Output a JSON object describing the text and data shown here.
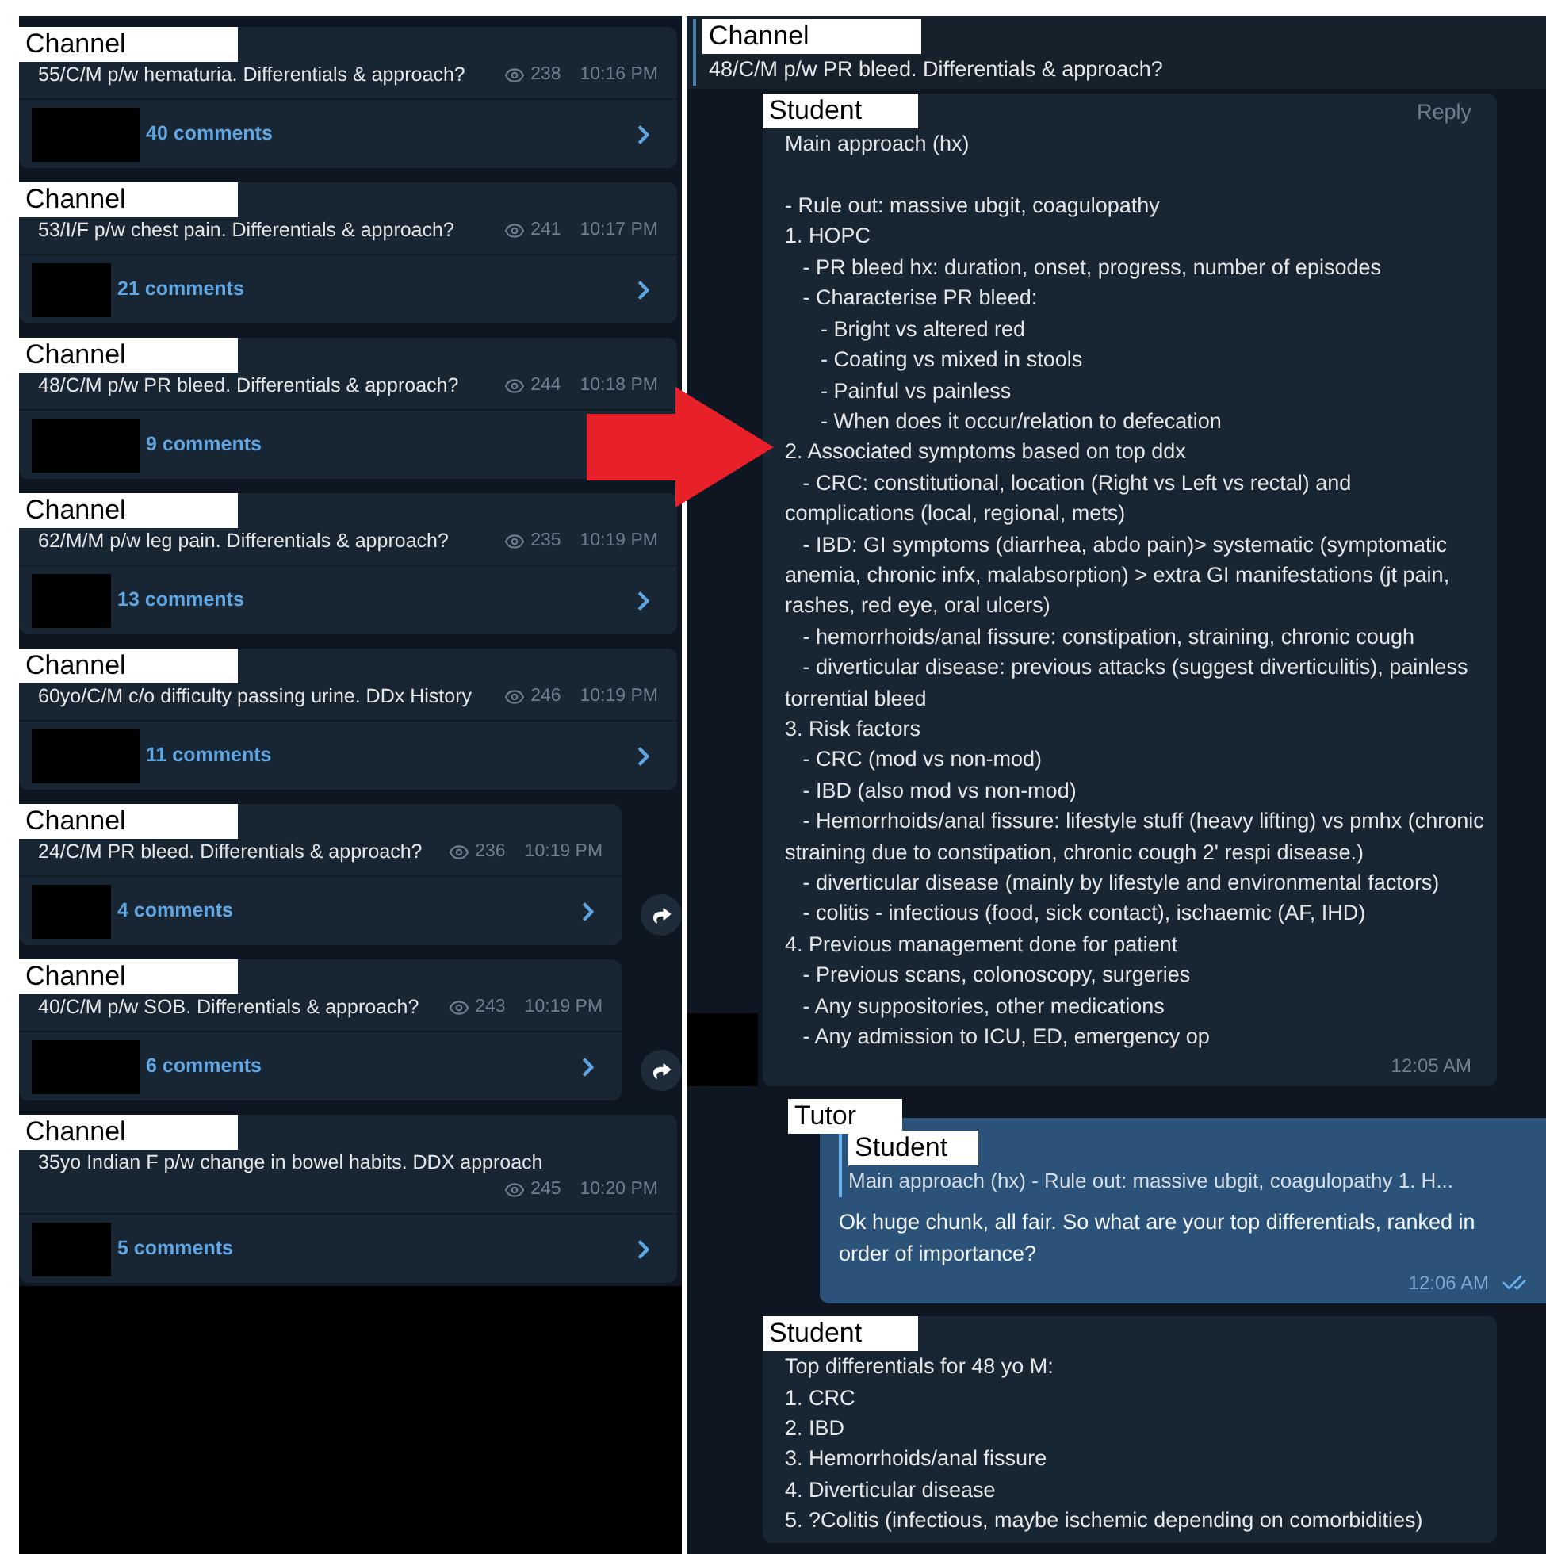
{
  "posts": [
    {
      "channel": "Channel",
      "text": "55/C/M p/w hematuria. Differentials & approach?",
      "views": "238",
      "time": "10:16 PM",
      "comments": "40 comments",
      "share_button": false,
      "arrow_annotation": false
    },
    {
      "channel": "Channel",
      "text": "53/I/F p/w chest pain. Differentials & approach?",
      "views": "241",
      "time": "10:17 PM",
      "comments": "21 comments",
      "share_button": false,
      "arrow_annotation": false
    },
    {
      "channel": "Channel",
      "text": "48/C/M p/w PR bleed. Differentials & approach?",
      "views": "244",
      "time": "10:18 PM",
      "comments": "9 comments",
      "share_button": false,
      "arrow_annotation": true
    },
    {
      "channel": "Channel",
      "text": "62/M/M p/w leg pain. Differentials & approach?",
      "views": "235",
      "time": "10:19 PM",
      "comments": "13 comments",
      "share_button": false,
      "arrow_annotation": false
    },
    {
      "channel": "Channel",
      "text": "60yo/C/M c/o difficulty passing urine. DDx History",
      "views": "246",
      "time": "10:19 PM",
      "comments": "11 comments",
      "share_button": false,
      "arrow_annotation": false
    },
    {
      "channel": "Channel",
      "text": "24/C/M PR bleed. Differentials & approach?",
      "views": "236",
      "time": "10:19 PM",
      "comments": "4 comments",
      "share_button": true,
      "arrow_annotation": false
    },
    {
      "channel": "Channel",
      "text": "40/C/M p/w SOB. Differentials & approach?",
      "views": "243",
      "time": "10:19 PM",
      "comments": "6 comments",
      "share_button": true,
      "arrow_annotation": false
    },
    {
      "channel": "Channel",
      "text": "35yo Indian F p/w change in bowel habits. DDX approach",
      "views": "245",
      "time": "10:20 PM",
      "comments": "5 comments",
      "share_button": false,
      "arrow_annotation": false
    }
  ],
  "thread": {
    "header": {
      "channel": "Channel",
      "text": "48/C/M p/w PR bleed. Differentials & approach?"
    },
    "messages": [
      {
        "kind": "incoming",
        "sender": "Student",
        "reply_label": "Reply",
        "avatar_redacted": true,
        "text": "Main approach (hx)\n\n- Rule out: massive ubgit, coagulopathy\n1. HOPC\n   - PR bleed hx: duration, onset, progress, number of episodes\n   - Characterise PR bleed:\n      - Bright vs altered red\n      - Coating vs mixed in stools\n      - Painful vs painless\n      - When does it occur/relation to defecation\n2. Associated symptoms based on top ddx\n   - CRC: constitutional, location (Right vs Left vs rectal) and complications (local, regional, mets)\n   - IBD: GI symptoms (diarrhea, abdo pain)> systematic (symptomatic anemia, chronic infx, malabsorption) > extra GI manifestations (jt pain, rashes, red eye, oral ulcers)\n   - hemorrhoids/anal fissure: constipation, straining, chronic cough\n   - diverticular disease: previous attacks (suggest diverticulitis), painless torrential bleed\n3. Risk factors\n   - CRC (mod vs non-mod)\n   - IBD (also mod vs non-mod)\n   - Hemorrhoids/anal fissure: lifestyle stuff (heavy lifting) vs pmhx (chronic straining due to constipation, chronic cough 2' respi disease.)\n   - diverticular disease (mainly by lifestyle and environmental factors)\n   - colitis - infectious (food, sick contact), ischaemic (AF, IHD)\n4. Previous management done for patient\n   - Previous scans, colonoscopy, surgeries\n   - Any suppositories, other medications\n   - Any admission to ICU, ED, emergency op",
        "time": "12:05 AM"
      },
      {
        "kind": "outgoing",
        "sender": "Tutor",
        "avatar_redacted": false,
        "quote": {
          "sender": "Student",
          "text": "Main approach (hx)  - Rule out: massive ubgit, coagulopathy 1. H..."
        },
        "text": "Ok huge chunk, all fair. So what are your top differentials, ranked in order of importance?",
        "time": "12:06 AM",
        "read": true
      },
      {
        "kind": "incoming",
        "sender": "Student",
        "avatar_redacted": false,
        "text": "Top differentials for 48 yo M:\n1. CRC\n2. IBD\n3. Hemorrhoids/anal fissure\n4. Diverticular disease\n5. ?Colitis (infectious, maybe ischemic depending on comorbidities)"
      }
    ]
  }
}
